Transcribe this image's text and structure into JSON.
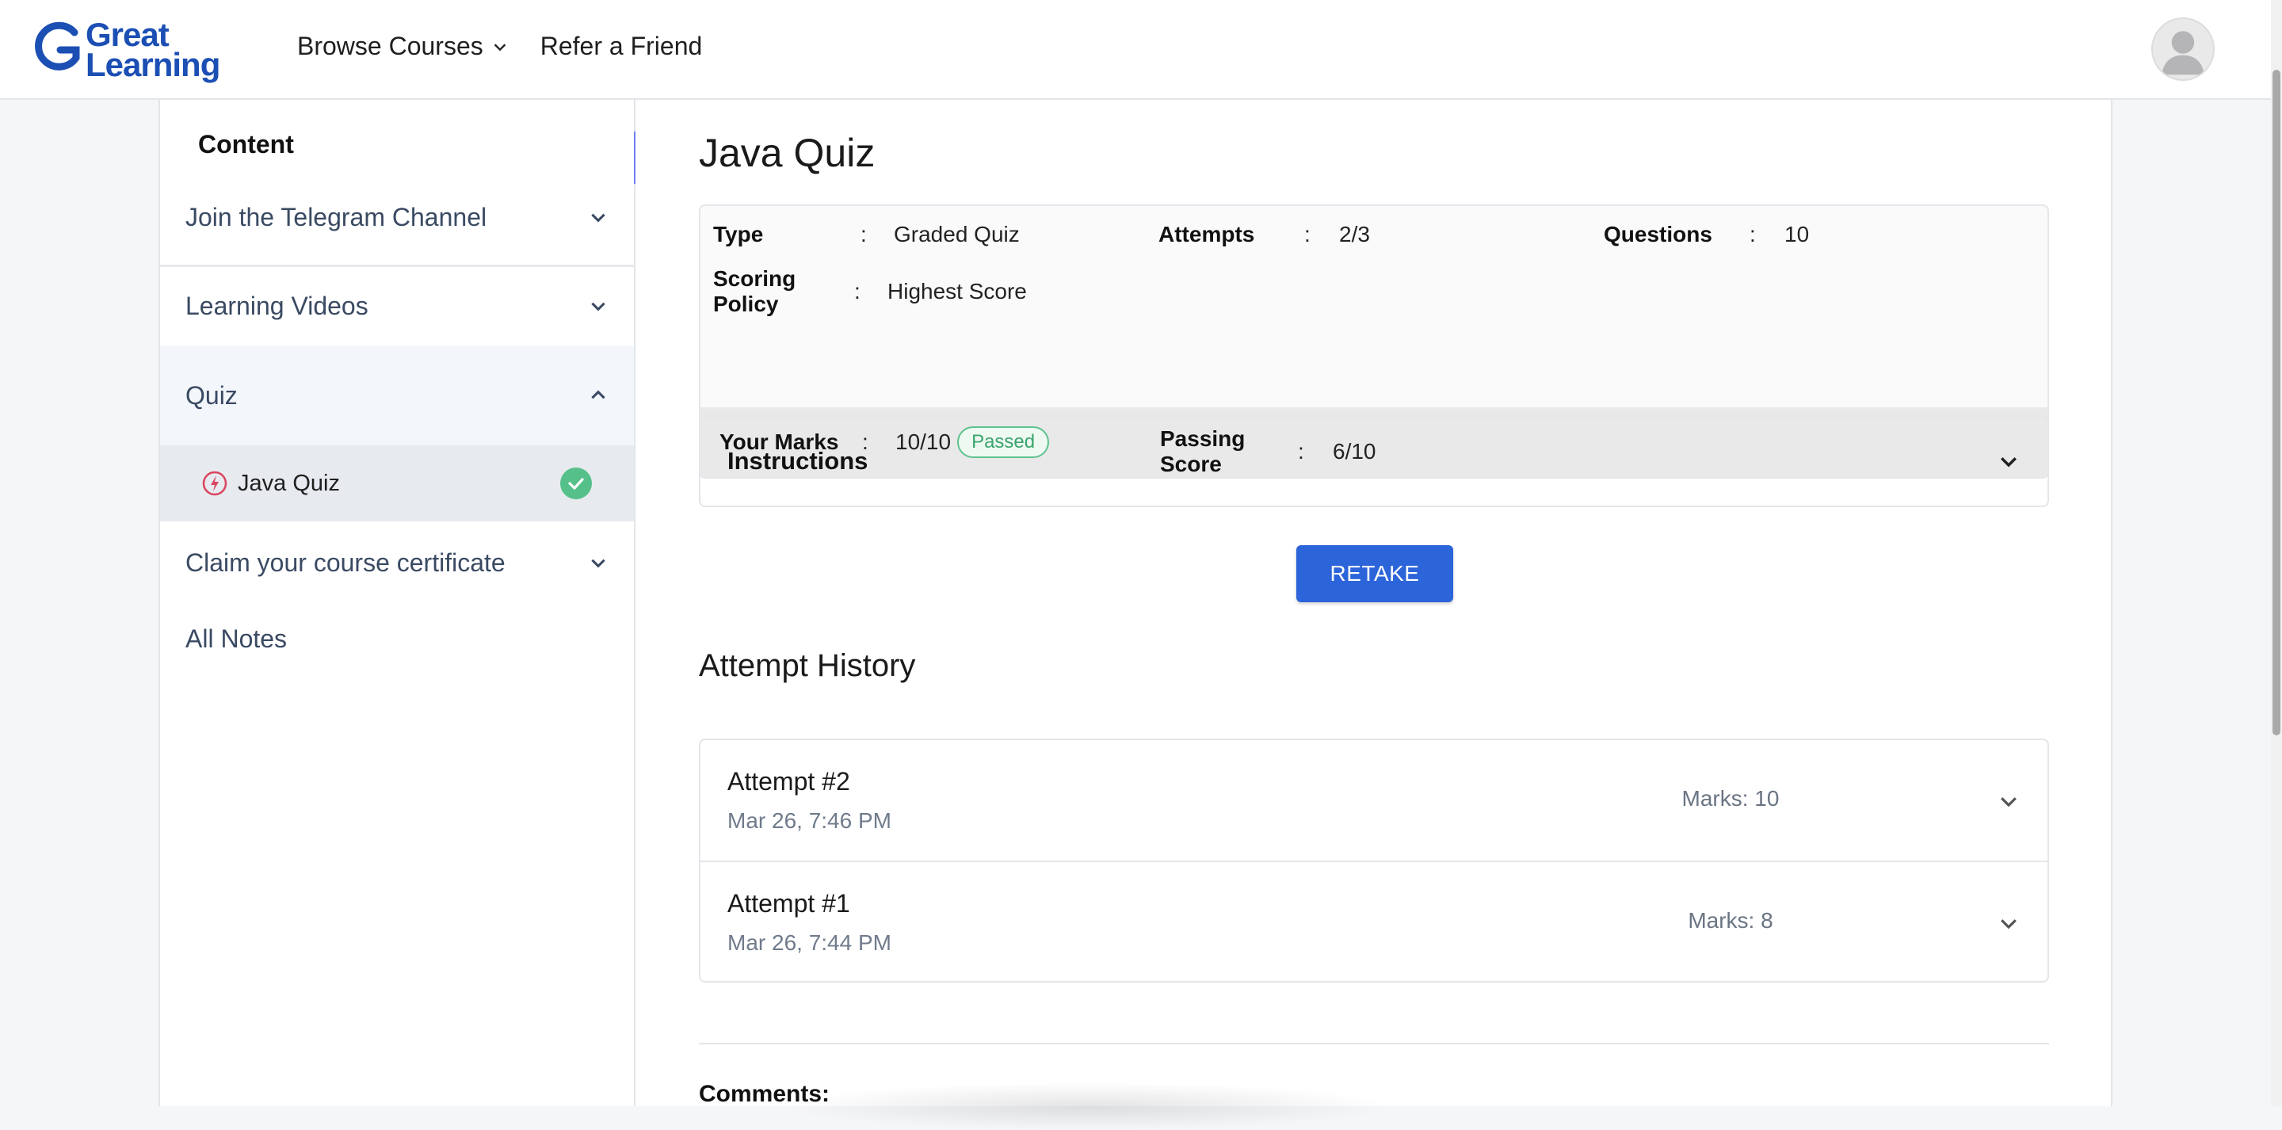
{
  "header": {
    "logo": {
      "line1": "Great",
      "line2": "Learning"
    },
    "nav": {
      "browse": "Browse Courses",
      "refer": "Refer a Friend"
    }
  },
  "sidebar": {
    "title": "Content",
    "sections": [
      {
        "label": "Join the Telegram Channel",
        "icon": "chevron-down-icon"
      },
      {
        "label": "Learning Videos",
        "icon": "chevron-down-icon"
      },
      {
        "label": "Quiz",
        "icon": "chevron-up-icon"
      },
      {
        "label": "Claim your course certificate",
        "icon": "chevron-down-icon"
      },
      {
        "label": "All Notes"
      }
    ],
    "quiz_item": {
      "label": "Java Quiz",
      "status": "completed"
    }
  },
  "main": {
    "title": "Java Quiz",
    "info": {
      "type_label": "Type",
      "type_value": "Graded Quiz",
      "attempts_label": "Attempts",
      "attempts_value": "2/3",
      "questions_label": "Questions",
      "questions_value": "10",
      "scoring_label": "Scoring Policy",
      "scoring_value": "Highest Score",
      "marks_label": "Your Marks",
      "marks_value": "10/10",
      "marks_badge": "Passed",
      "passing_label": "Passing Score",
      "passing_value": "6/10",
      "colon": ":"
    },
    "instructions_label": "Instructions",
    "retake_label": "RETAKE",
    "attempt_history_title": "Attempt History",
    "attempts": [
      {
        "title": "Attempt #2",
        "date": "Mar 26, 7:46 PM",
        "marks": "Marks: 10"
      },
      {
        "title": "Attempt #1",
        "date": "Mar 26, 7:44 PM",
        "marks": "Marks: 8"
      }
    ],
    "comments_label": "Comments:"
  },
  "colors": {
    "brand": "#1c4fb4",
    "primary_button": "#2c64d9",
    "collapse_button": "#6d7cf2",
    "passed": "#3aa56c"
  }
}
